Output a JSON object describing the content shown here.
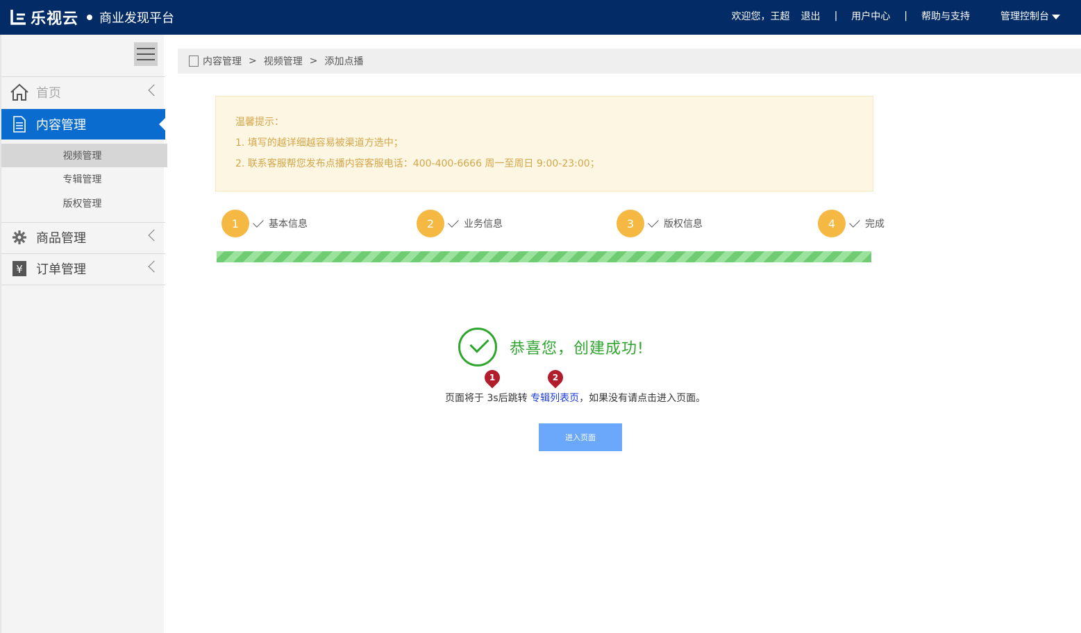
{
  "header": {
    "logo_text": "乐视云",
    "platform": "商业发现平台",
    "welcome": "欢迎您，王超",
    "logout": "退出",
    "user_center": "用户中心",
    "help": "帮助与支持",
    "console": "管理控制台",
    "separator": "|"
  },
  "sidebar": {
    "home": "首页",
    "content_mgmt": "内容管理",
    "sub_items": [
      "视频管理",
      "专辑管理",
      "版权管理"
    ],
    "goods_mgmt": "商品管理",
    "order_mgmt": "订单管理"
  },
  "breadcrumb": {
    "items": [
      "内容管理",
      "视频管理",
      "添加点播"
    ],
    "separator": ">"
  },
  "tips": {
    "title": "温馨提示：",
    "lines": [
      "1. 填写的越详细越容易被渠道方选中；",
      "2. 联系客服帮您发布点播内容客服电话：400-400-6666 周一至周日 9:00-23:00；"
    ]
  },
  "steps": [
    {
      "num": "1",
      "label": "基本信息"
    },
    {
      "num": "2",
      "label": "业务信息"
    },
    {
      "num": "3",
      "label": "版权信息"
    },
    {
      "num": "4",
      "label": "完成"
    }
  ],
  "progress": 1.0,
  "success": {
    "message": "恭喜您，创建成功!",
    "redirect_prefix": "页面将于 ",
    "seconds": "3s后跳转",
    "link": "专辑列表页",
    "redirect_suffix": "，如果没有请点击进入页面。",
    "button": "进入页面"
  },
  "pins": [
    "1",
    "2"
  ],
  "colors": {
    "topbar": "#032c66",
    "active_menu": "#0a6cce",
    "step_circle": "#f5b843",
    "success_green": "#2ea52e",
    "button_blue": "#6ba7fb",
    "link_blue": "#1a3bd6",
    "pin_red": "#b11d2b"
  }
}
